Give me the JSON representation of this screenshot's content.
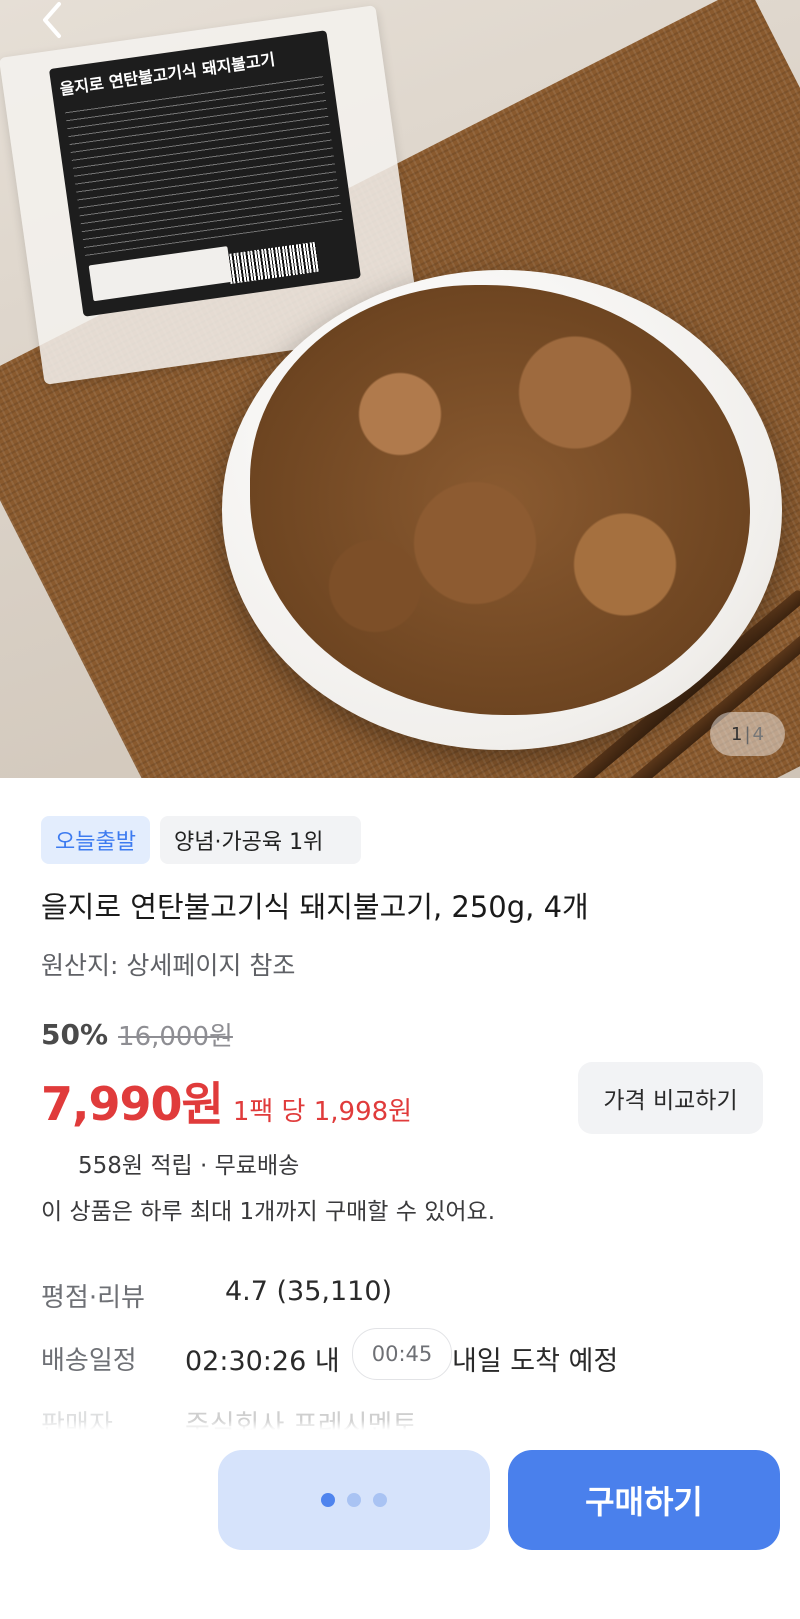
{
  "hero": {
    "package_title": "을지로 연탄불고기식 돼지불고기",
    "counter_current": "1",
    "counter_separator": "|",
    "counter_total": "4",
    "back_icon": "chevron-left-icon"
  },
  "badges": {
    "today_ship": "오늘출발",
    "ranking": "양념·가공육 1위"
  },
  "product": {
    "title": "을지로 연탄불고기식 돼지불고기, 250g, 4개",
    "origin": "원산지: 상세페이지 참조"
  },
  "pricing": {
    "discount": "50%",
    "original_price": "16,000원",
    "price": "7,990원",
    "unit_price": "1팩 당 1,998원",
    "compare_label": "가격 비교하기",
    "points_shipping": "558원 적립 · 무료배송",
    "purchase_limit": "이 상품은 하루 최대 1개까지 구매할 수 있어요."
  },
  "details": {
    "rating_label": "평점·리뷰",
    "rating_value": "4.7 (35,110)",
    "delivery_label": "배송일정",
    "delivery_countdown": "02:30:26 내",
    "delivery_chip": "00:45",
    "delivery_text": "내일 도착 예정",
    "seller_label": "판매자",
    "seller_value": "주식회사 프레시멘토"
  },
  "bottom": {
    "buy_label": "구매하기",
    "more_icon": "more-dots-icon"
  },
  "colors": {
    "accent_blue": "#4a80ec",
    "price_red": "#e03b3b",
    "badge_blue_bg": "#e3edfd"
  }
}
